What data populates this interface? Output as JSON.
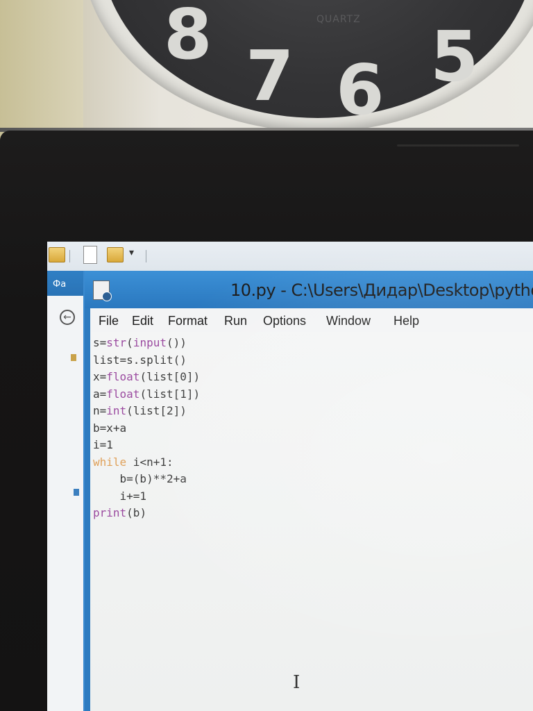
{
  "clock": {
    "numerals": [
      "8",
      "7",
      "6",
      "5"
    ],
    "brand": "QUARTZ"
  },
  "explorer": {
    "tab_label": "Фа",
    "back_icon": "arrow-left-circle-icon"
  },
  "window": {
    "title": "10.py - C:\\Users\\Дидар\\Desktop\\pytho",
    "icon": "idle-file-icon"
  },
  "menu": {
    "items": [
      "File",
      "Edit",
      "Format",
      "Run",
      "Options",
      "Window",
      "Help"
    ]
  },
  "editor": {
    "lines": [
      "s=str(input())",
      "list=s.split()",
      "x=float(list[0])",
      "a=float(list[1])",
      "n=int(list[2])",
      "b=x+a",
      "i=1",
      "while i<n+1:",
      "    b=(b)**2+a",
      "    i+=1",
      "print(b)"
    ],
    "cursor_icon": "text-cursor-icon"
  }
}
